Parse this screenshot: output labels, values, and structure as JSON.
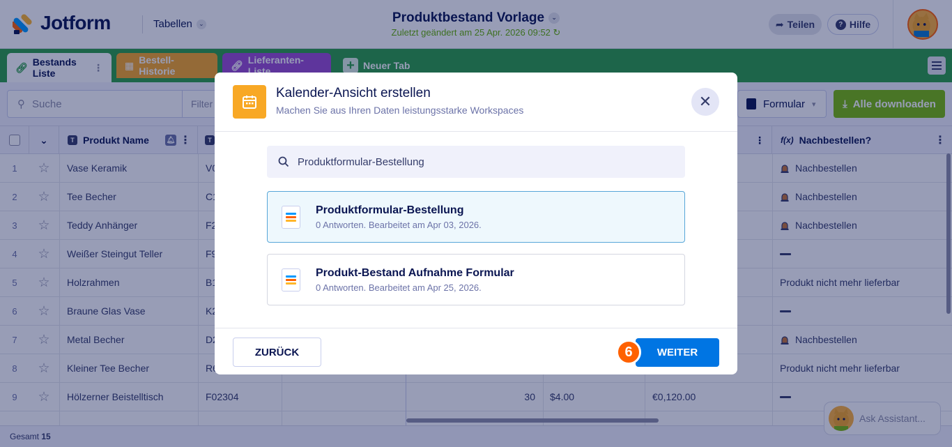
{
  "header": {
    "logo_text": "Jotform",
    "tables_dropdown": "Tabellen",
    "doc_title": "Produktbestand Vorlage",
    "doc_subtitle": "Zuletzt geändert am 25 Apr. 2026 09:52",
    "share_label": "Teilen",
    "help_label": "Hilfe"
  },
  "tabs": [
    {
      "label": "Bestands Liste"
    },
    {
      "label": "Bestell-Historie"
    },
    {
      "label": "Lieferanten-Liste"
    },
    {
      "label": "Neuer Tab"
    }
  ],
  "toolbar": {
    "search_placeholder": "Suche",
    "filter_label": "Filter",
    "form_label": "Formular",
    "download_label": "Alle downloaden"
  },
  "columns": {
    "name": "Produkt Name",
    "reorder": "Nachbestellen?"
  },
  "rows": [
    {
      "num": "1",
      "name": "Vase Keramik",
      "code": "V0",
      "qty": "",
      "price": "",
      "total": "",
      "reorder": "Nachbestellen",
      "flag": true
    },
    {
      "num": "2",
      "name": "Tee Becher",
      "code": "C1",
      "qty": "",
      "price": "",
      "total": "",
      "reorder": "Nachbestellen",
      "flag": true
    },
    {
      "num": "3",
      "name": "Teddy Anhänger",
      "code": "F2",
      "qty": "",
      "price": "",
      "total": "",
      "reorder": "Nachbestellen",
      "flag": true
    },
    {
      "num": "4",
      "name": "Weißer Steingut Teller",
      "code": "F9",
      "qty": "",
      "price": "",
      "total": "",
      "reorder": "",
      "flag": false,
      "dash": true
    },
    {
      "num": "5",
      "name": "Holzrahmen",
      "code": "B1",
      "qty": "",
      "price": "",
      "total": "",
      "reorder": "Produkt nicht mehr lieferbar",
      "flag": false
    },
    {
      "num": "6",
      "name": "Braune Glas Vase",
      "code": "K2",
      "qty": "",
      "price": "",
      "total": "",
      "reorder": "",
      "flag": false,
      "dash": true
    },
    {
      "num": "7",
      "name": "Metal Becher",
      "code": "D2",
      "qty": "",
      "price": "",
      "total": "",
      "reorder": "Nachbestellen",
      "flag": true
    },
    {
      "num": "8",
      "name": "Kleiner Tee Becher",
      "code": "R6",
      "qty": "",
      "price": "",
      "total": "",
      "reorder": "Produkt nicht mehr lieferbar",
      "flag": false
    },
    {
      "num": "9",
      "name": "Hölzerner Beistelltisch",
      "code": "F02304",
      "qty": "30",
      "price": "$4.00",
      "total": "€0,120.00",
      "reorder": "",
      "flag": false,
      "dash": true
    }
  ],
  "footer": {
    "total_label": "Gesamt",
    "total_count": "15"
  },
  "assistant_label": "Ask Assistant...",
  "modal": {
    "title": "Kalender-Ansicht erstellen",
    "subtitle": "Machen Sie aus Ihren Daten leistungsstarke Workspaces",
    "search_value": "Produktformular-Bestellung",
    "forms": [
      {
        "title": "Produktformular-Bestellung",
        "meta": "0 Antworten. Bearbeitet am Apr 03, 2026.",
        "selected": true
      },
      {
        "title": "Produkt-Bestand Aufnahme Formular",
        "meta": "0 Antworten. Bearbeitet am Apr 25, 2026.",
        "selected": false
      }
    ],
    "back_label": "ZURÜCK",
    "next_label": "WEITER"
  },
  "step_badge": "6",
  "colors": {
    "green": "#2b9f45",
    "orange": "#f8a825",
    "purple": "#9c4dd3",
    "blue": "#0075e3",
    "badge": "#ff6100"
  }
}
